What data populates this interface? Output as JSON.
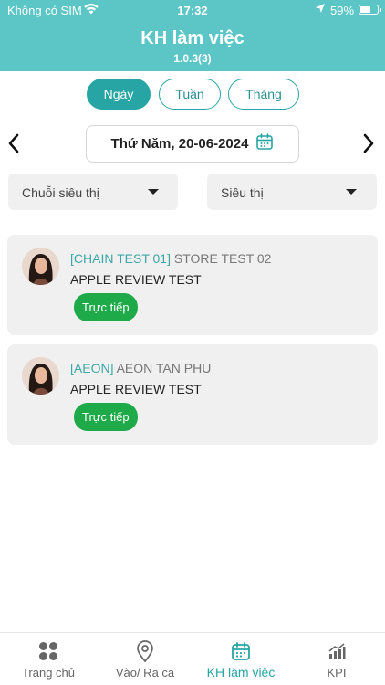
{
  "status_bar": {
    "carrier": "Không có SIM",
    "time": "17:32",
    "battery": "59%"
  },
  "header": {
    "title": "KH làm việc",
    "version": "1.0.3(3)"
  },
  "segments": [
    {
      "label": "Ngày",
      "active": true
    },
    {
      "label": "Tuần",
      "active": false
    },
    {
      "label": "Tháng",
      "active": false
    }
  ],
  "date_nav": {
    "date": "Thứ Năm, 20-06-2024"
  },
  "filters": {
    "chain_label": "Chuỗi siêu thị",
    "store_label": "Siêu thị"
  },
  "plans": [
    {
      "code": "[CHAIN TEST 01]",
      "store": "STORE TEST 02",
      "subtitle": "APPLE REVIEW TEST",
      "badge": "Trực tiếp"
    },
    {
      "code": "[AEON]",
      "store": "AEON TAN PHU",
      "subtitle": "APPLE REVIEW TEST",
      "badge": "Trực tiếp"
    }
  ],
  "tabs": [
    {
      "label": "Trang chủ",
      "icon": "grid-icon",
      "active": false
    },
    {
      "label": "Vào/ Ra ca",
      "icon": "location-pin-icon",
      "active": false
    },
    {
      "label": "KH làm việc",
      "icon": "calendar-icon",
      "active": true
    },
    {
      "label": "KPI",
      "icon": "chart-icon",
      "active": false
    }
  ],
  "colors": {
    "header": "#5cc6c6",
    "accent": "#27a4a4",
    "badge": "#1faa4a"
  }
}
